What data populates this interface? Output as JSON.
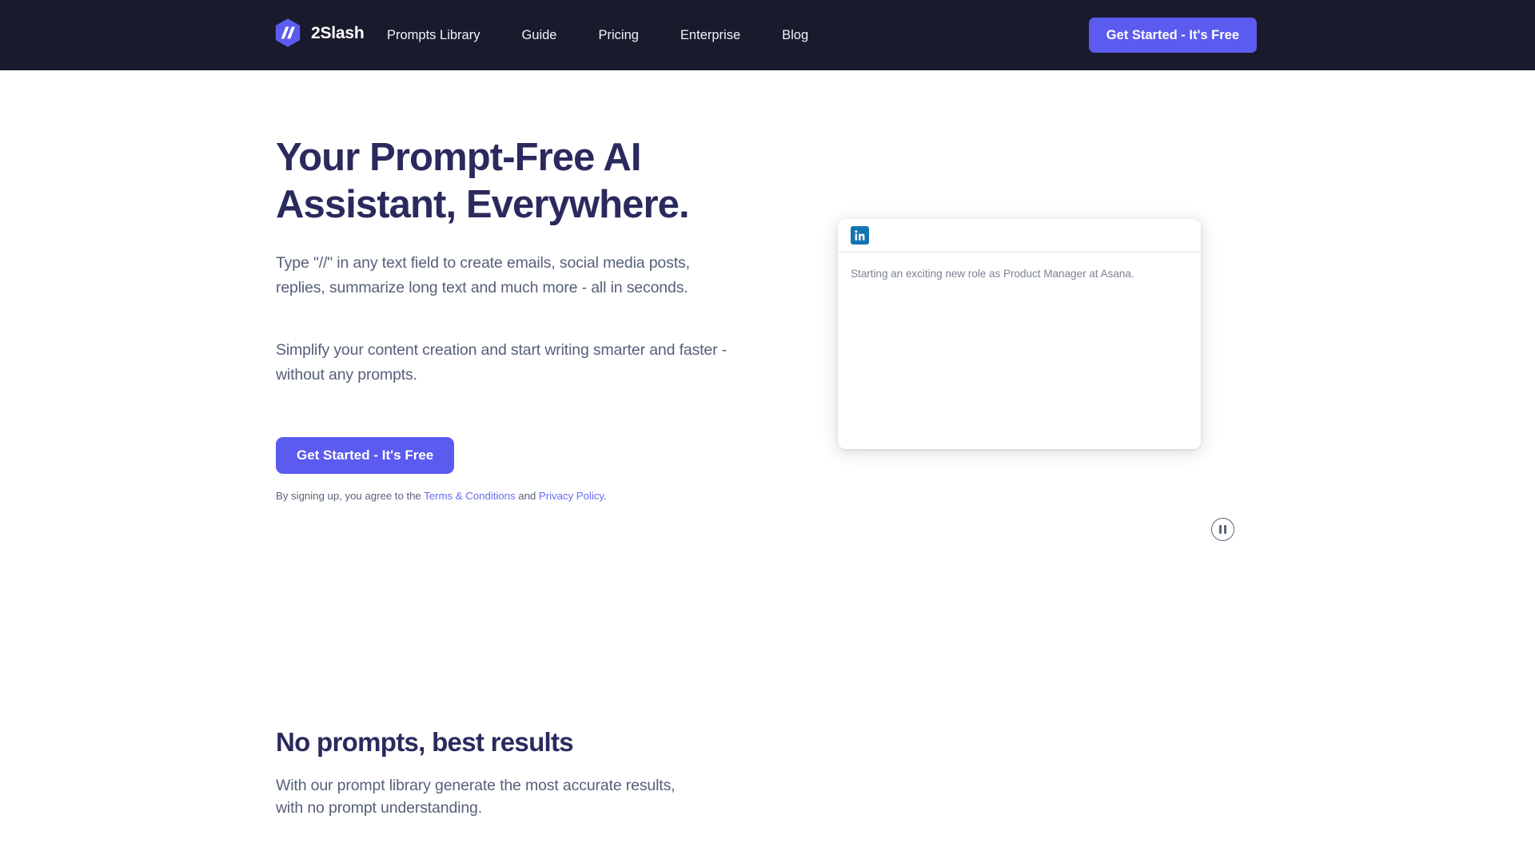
{
  "brand": {
    "name": "2Slash",
    "logo_icon": "hexagon-double-slash-logo",
    "logo_color": "#5b5bf0"
  },
  "header": {
    "background_color": "#191a2c",
    "nav": [
      {
        "label": "Prompts  Library"
      },
      {
        "label": "Guide"
      },
      {
        "label": "Pricing"
      },
      {
        "label": "Enterprise"
      },
      {
        "label": "Blog"
      }
    ],
    "cta_label": "Get Started - It's Free",
    "cta_color": "#5b5bf0"
  },
  "hero": {
    "title_line_1": "Your Prompt-Free AI",
    "title_line_2": "Assistant, Everywhere.",
    "paragraph_1": "Type \"//\" in any text field to create emails, social media posts, replies, summarize long text and much more - all in seconds.",
    "paragraph_2": "Simplify your content creation and start writing smarter and faster - without any prompts.",
    "cta_label": "Get Started - It's Free",
    "legal_prefix": "By signing up, you agree to the ",
    "legal_terms_link": "Terms & Conditions",
    "legal_middle": " and ",
    "legal_privacy_link": "Privacy Policy",
    "legal_suffix": ".",
    "title_color": "#2b2a5e",
    "link_color": "#6b6bf2"
  },
  "demo": {
    "platform_icon": "linkedin-icon",
    "platform_color": "#1275b1",
    "post_text": "Starting an exciting new role as Product Manager at Asana.",
    "pause_icon": "pause-circle-icon"
  },
  "section": {
    "title": "No prompts, best results",
    "paragraph": "With our prompt library generate the most accurate results, with no prompt understanding."
  }
}
